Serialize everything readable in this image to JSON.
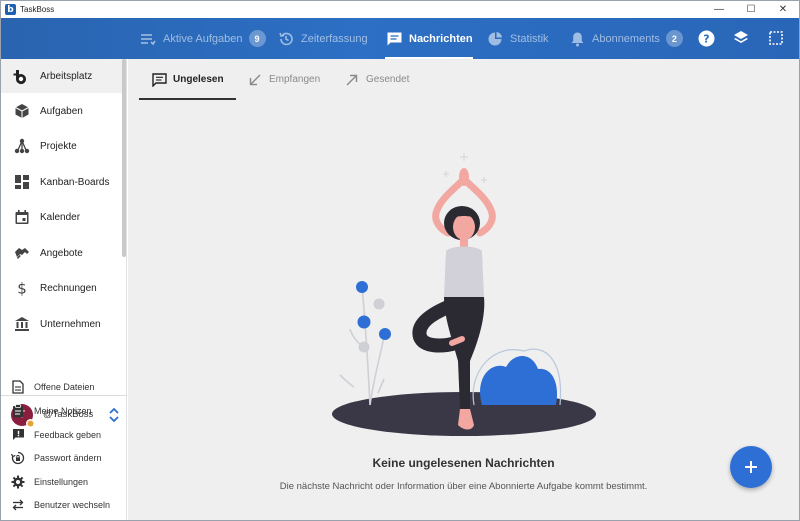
{
  "window": {
    "title": "TaskBoss",
    "logo_letter": "b",
    "controls": {
      "minimize": "—",
      "maximize": "☐",
      "close": "✕"
    }
  },
  "topbar": {
    "tabs": [
      {
        "label": "Aktive Aufgaben",
        "icon": "list-icon",
        "badge": "9"
      },
      {
        "label": "Zeiterfassung",
        "icon": "history-icon"
      },
      {
        "label": "Nachrichten",
        "icon": "message-icon"
      },
      {
        "label": "Statistik",
        "icon": "pie-chart-icon"
      },
      {
        "label": "Abonnements",
        "icon": "bell-icon",
        "badge": "2"
      }
    ],
    "active_tab": "Nachrichten",
    "right_icons": [
      "help-icon",
      "layers-icon",
      "fullscreen-icon"
    ]
  },
  "sidebar": {
    "items": [
      {
        "label": "Arbeitsplatz",
        "icon": "taskboss-logo-icon"
      },
      {
        "label": "Aufgaben",
        "icon": "cube-icon"
      },
      {
        "label": "Projekte",
        "icon": "hierarchy-icon"
      },
      {
        "label": "Kanban-Boards",
        "icon": "dashboard-icon"
      },
      {
        "label": "Kalender",
        "icon": "calendar-icon"
      },
      {
        "label": "Angebote",
        "icon": "handshake-icon"
      },
      {
        "label": "Rechnungen",
        "icon": "dollar-icon"
      },
      {
        "label": "Unternehmen",
        "icon": "bank-icon"
      }
    ],
    "active_item": "Arbeitsplatz",
    "user": {
      "initial": "T",
      "name": "@TaskBoss"
    },
    "secondary_items": [
      {
        "label": "Offene Dateien",
        "icon": "file-icon"
      },
      {
        "label": "Meine Notizen",
        "icon": "clipboard-icon"
      },
      {
        "label": "Feedback geben",
        "icon": "feedback-icon"
      },
      {
        "label": "Passwort ändern",
        "icon": "lock-reset-icon"
      },
      {
        "label": "Einstellungen",
        "icon": "settings-icon"
      },
      {
        "label": "Benutzer wechseln",
        "icon": "switch-user-icon"
      }
    ]
  },
  "main": {
    "subtabs": [
      {
        "label": "Ungelesen",
        "icon": "message-outline-icon"
      },
      {
        "label": "Empfangen",
        "icon": "arrow-down-left-icon"
      },
      {
        "label": "Gesendet",
        "icon": "arrow-up-right-icon"
      }
    ],
    "active_subtab": "Ungelesen",
    "empty_title": "Keine ungelesenen Nachrichten",
    "empty_subtitle": "Die nächste Nachricht oder Information über eine Abonnierte Aufgabe kommt bestimmt.",
    "fab_symbol": "+"
  },
  "colors": {
    "topbar": "#2c6fc4",
    "accent": "#2e6fd6",
    "avatar": "#8b1e3f",
    "main_bg": "#efefef"
  }
}
